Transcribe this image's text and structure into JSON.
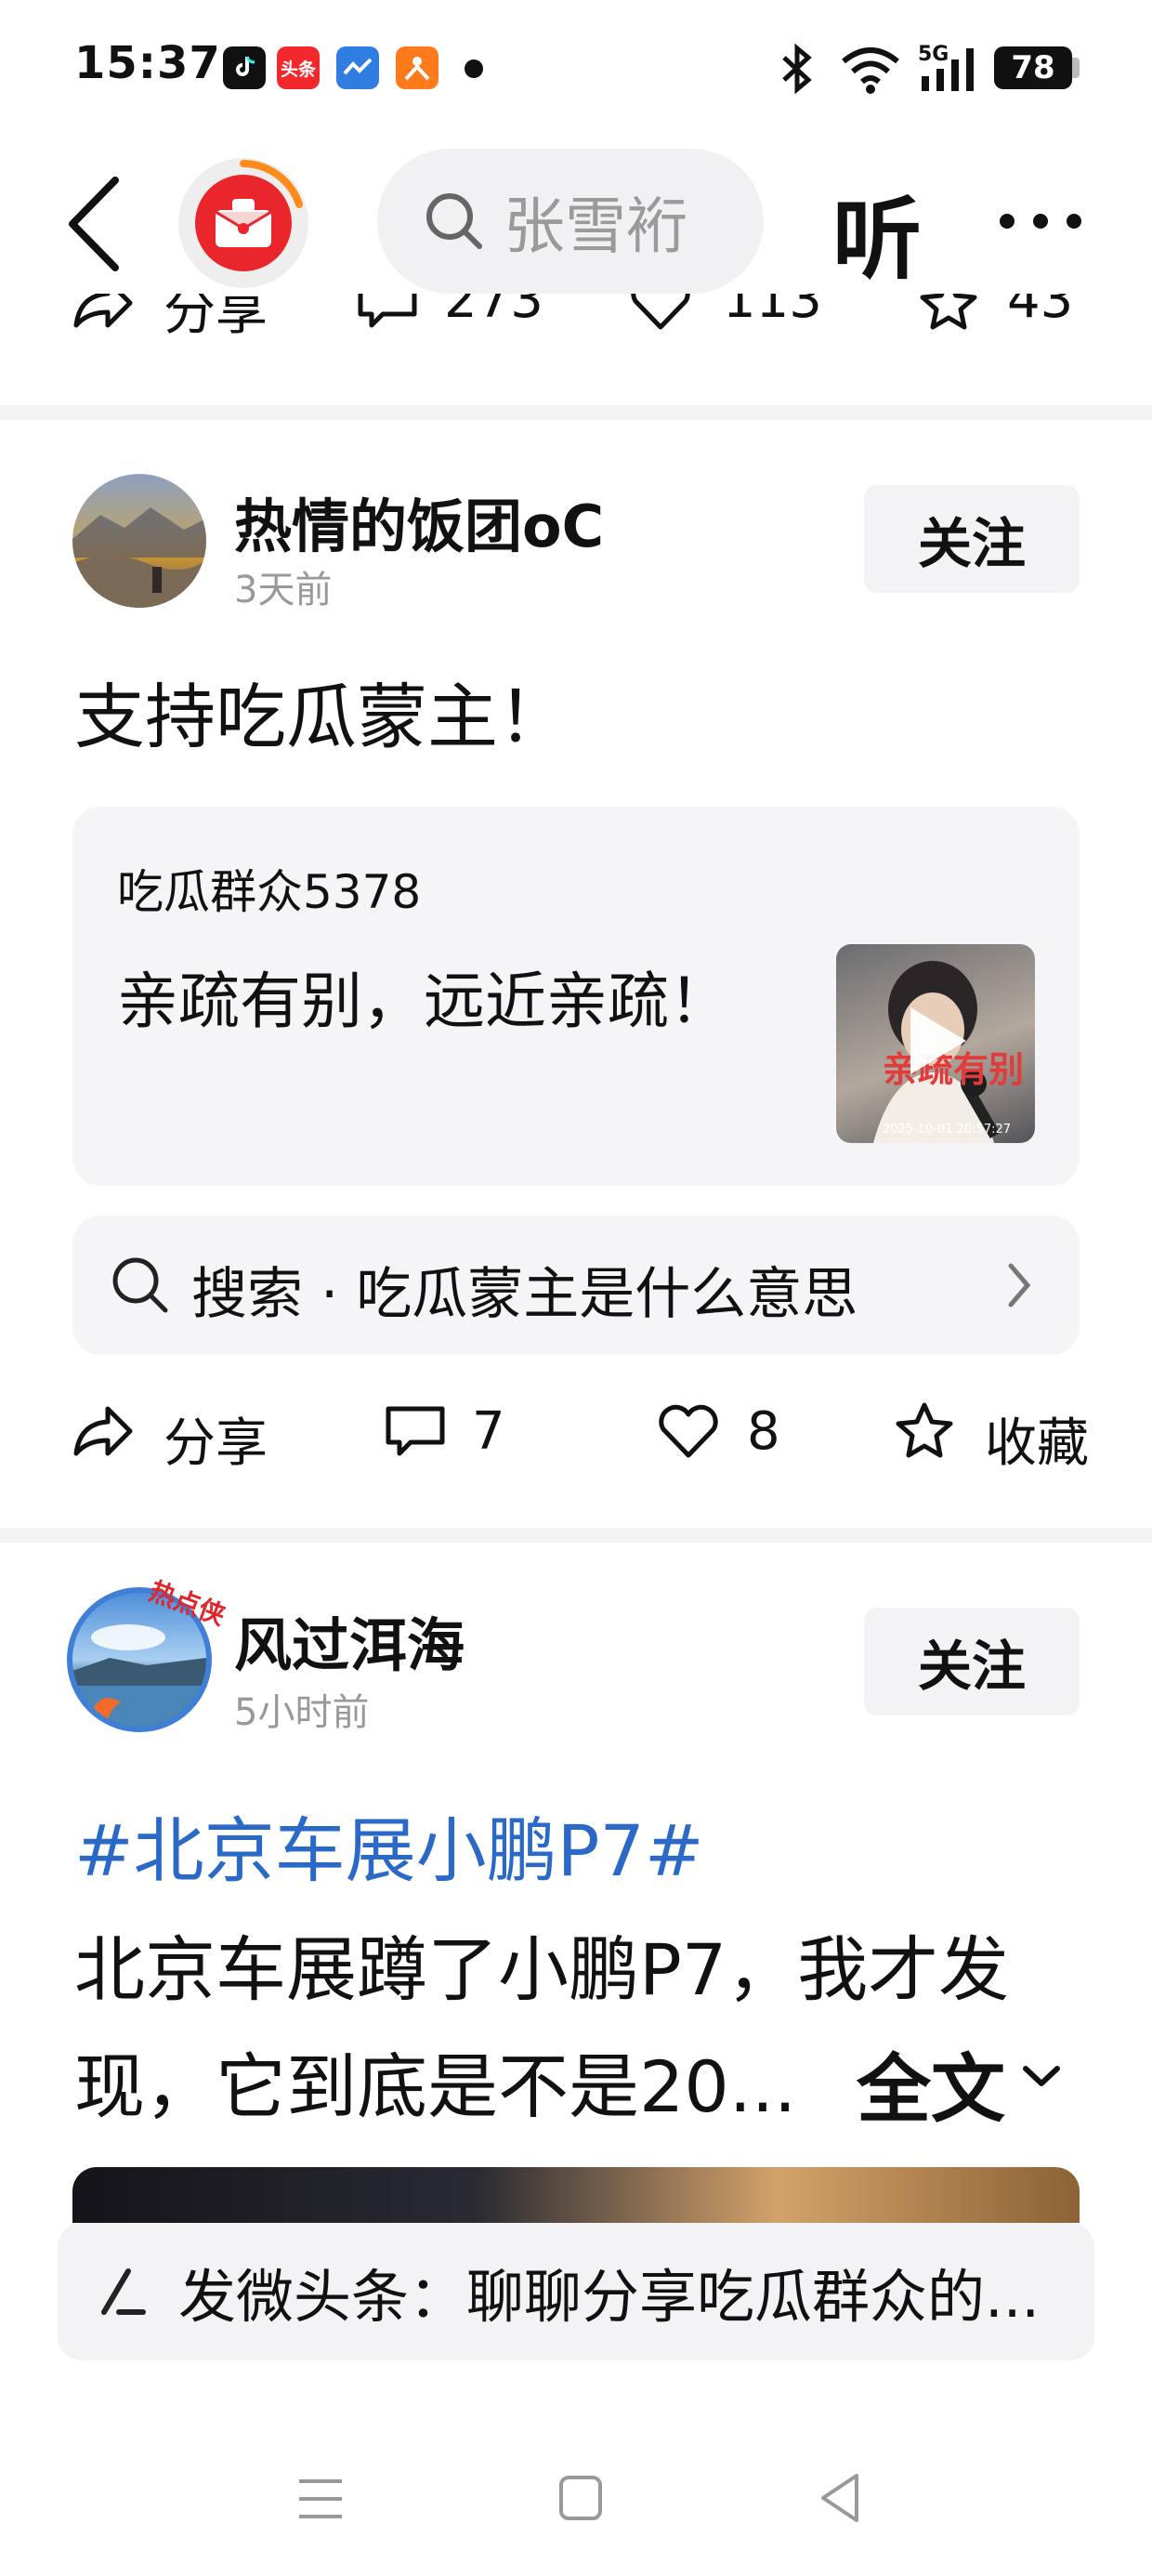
{
  "status_bar": {
    "time": "15:37",
    "app_icons": [
      {
        "name": "douyin-app-icon",
        "label": "",
        "color": "#111111"
      },
      {
        "name": "toutiao-app-icon",
        "label": "头条",
        "color": "#f2282d"
      },
      {
        "name": "blue-app-icon",
        "label": "",
        "color": "#2f7de1"
      },
      {
        "name": "orange-app-icon",
        "label": "",
        "color": "#ff7a1a"
      }
    ],
    "battery": "78",
    "network": "5G"
  },
  "top_nav": {
    "search_placeholder": "张雪裄",
    "listen_label": "听"
  },
  "prev_post_actions": {
    "share": "分享",
    "comments": "273",
    "likes": "113",
    "favorites": "43"
  },
  "post1": {
    "author": "热情的饭团oC",
    "time": "3天前",
    "follow": "关注",
    "text": "支持吃瓜蒙主！",
    "quote": {
      "author": "吃瓜群众5378",
      "text": "亲疏有别，远近亲疏！",
      "thumb_caption": "亲疏有别",
      "thumb_timestamp": "2025-10-01 20:57:27"
    },
    "search": {
      "prefix": "搜索",
      "dot": "·",
      "query": "吃瓜蒙主是什么意思"
    },
    "actions": {
      "share": "分享",
      "comments": "7",
      "likes": "8",
      "favorite": "收藏"
    }
  },
  "post2": {
    "author": "风过洱海",
    "avatar_badge": "热点侠",
    "time": "5小时前",
    "follow": "关注",
    "hashtag": "#北京车展小鹏P7#",
    "line1": "北京车展蹲了小鹏P7，我才发",
    "line2": "现，它到底是不是20...",
    "fulltext": "全文"
  },
  "compose": {
    "text": "发微头条：聊聊分享吃瓜群众的..."
  },
  "colors": {
    "accent_blue": "#2b69c9",
    "brand_red": "#e8262b",
    "card_bg": "#f5f5f7"
  }
}
